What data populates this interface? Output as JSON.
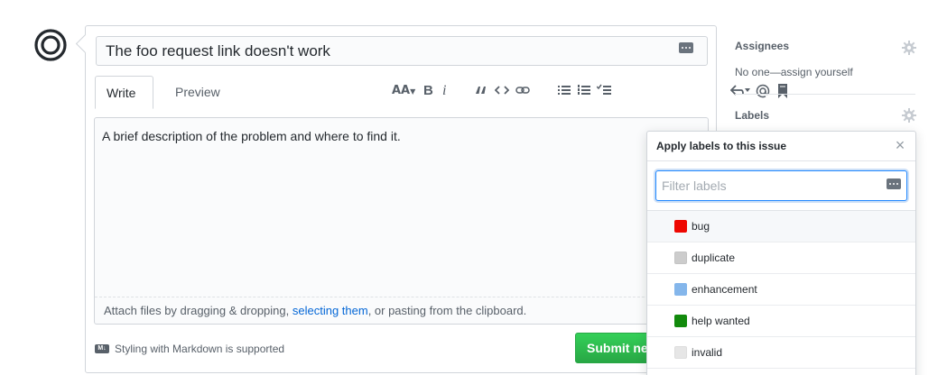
{
  "issue": {
    "title_value": "The foo request link doesn't work",
    "tabs": [
      {
        "label": "Write"
      },
      {
        "label": "Preview"
      }
    ],
    "toolbar": {
      "header_label": "AA",
      "bold_label": "B",
      "italic_label": "i"
    },
    "body_text": "A brief description of the problem and where to find it.",
    "attach": {
      "prefix": "Attach files by dragging & dropping, ",
      "link": "selecting them",
      "suffix": ", or pasting from the clipboard."
    },
    "markdown_note": "Styling with Markdown is supported",
    "markdown_icon_text": "M↓",
    "submit_label": "Submit new issue"
  },
  "sidebar": {
    "assignees": {
      "heading": "Assignees",
      "value": "No one—assign yourself"
    },
    "labels": {
      "heading": "Labels"
    }
  },
  "label_popover": {
    "title": "Apply labels to this issue",
    "close_glyph": "×",
    "filter_placeholder": "Filter labels",
    "items": [
      {
        "name": "bug",
        "color": "#ee0701"
      },
      {
        "name": "duplicate",
        "color": "#cccccc"
      },
      {
        "name": "enhancement",
        "color": "#84b6eb"
      },
      {
        "name": "help wanted",
        "color": "#128a0c"
      },
      {
        "name": "invalid",
        "color": "#e6e6e6"
      }
    ]
  },
  "colors": {
    "accent": "#0366d6",
    "submit": "#28a745",
    "avatar": "#24292e"
  }
}
